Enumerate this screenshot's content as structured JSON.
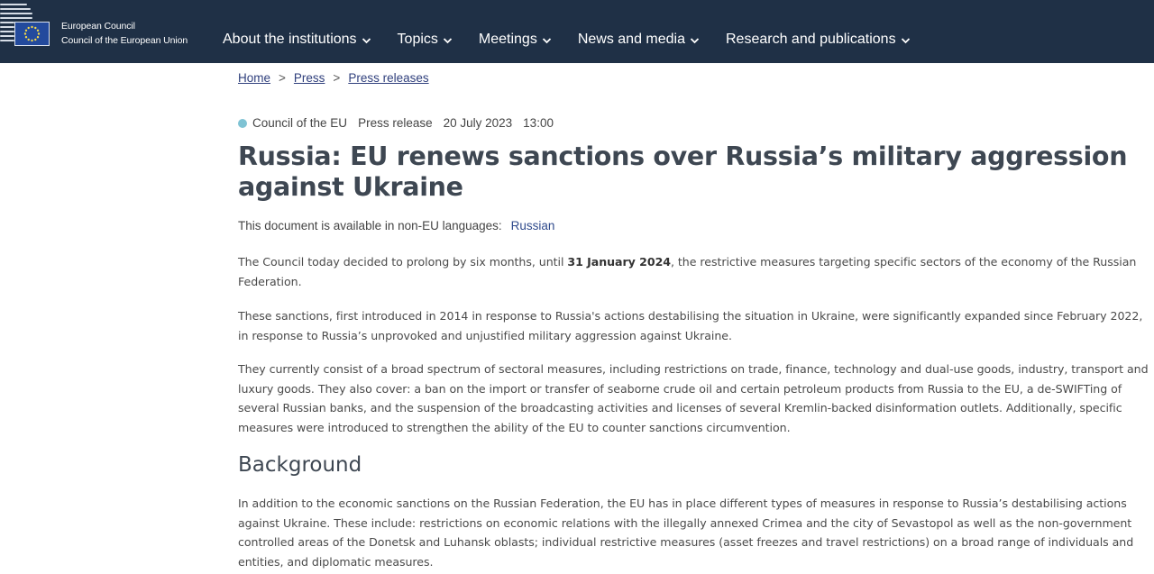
{
  "header": {
    "institution_line1": "European Council",
    "institution_line2": "Council of the European Union",
    "nav": [
      {
        "label": "About the institutions"
      },
      {
        "label": "Topics"
      },
      {
        "label": "Meetings"
      },
      {
        "label": "News and media"
      },
      {
        "label": "Research and publications"
      }
    ]
  },
  "breadcrumb": {
    "items": [
      "Home",
      "Press",
      "Press releases"
    ],
    "separator": ">"
  },
  "meta": {
    "source": "Council of the EU",
    "type": "Press release",
    "date": "20 July 2023",
    "time": "13:00",
    "dot_color": "#7fc3d4"
  },
  "article": {
    "title": "Russia: EU renews sanctions over Russia’s military aggression against Ukraine",
    "languages_label": "This document is available in non-EU languages:",
    "languages": [
      "Russian"
    ],
    "p1_before": "The Council today decided to prolong by six months, until ",
    "p1_bold": "31 January 2024",
    "p1_after": ", the restrictive measures targeting specific sectors of the economy of the Russian Federation.",
    "p2": "These sanctions, first introduced in 2014 in response to Russia's actions destabilising the situation in Ukraine, were significantly expanded since February 2022, in response to Russia’s unprovoked and unjustified military aggression against Ukraine.",
    "p3": "They currently consist of a broad spectrum of sectoral measures, including restrictions on trade, finance, technology and dual-use goods, industry, transport and luxury goods. They also cover: a ban on the import or transfer of seaborne crude oil and certain petroleum products from Russia to the EU, a de-SWIFTing of several Russian banks, and the suspension of the broadcasting activities and licenses of several Kremlin-backed disinformation outlets. Additionally, specific measures were introduced to strengthen the ability of the EU to counter sanctions circumvention.",
    "background_heading": "Background",
    "p4": "In addition to the economic sanctions on the Russian Federation, the EU has in place different types of measures in response to Russia’s destabilising actions against Ukraine. These include: restrictions on economic relations with the illegally annexed Crimea and the city of Sevastopol as well as the non-government controlled areas of the Donetsk and Luhansk oblasts; individual restrictive measures (asset freezes and travel restrictions) on a broad range of individuals and entities, and diplomatic measures."
  },
  "colors": {
    "header_bg": "#1f3046",
    "link": "#2f3f7c",
    "title": "#3e4752"
  },
  "icons": {
    "logo": "eu-flag-icon",
    "nav_chevron": "chevron-down-icon"
  }
}
